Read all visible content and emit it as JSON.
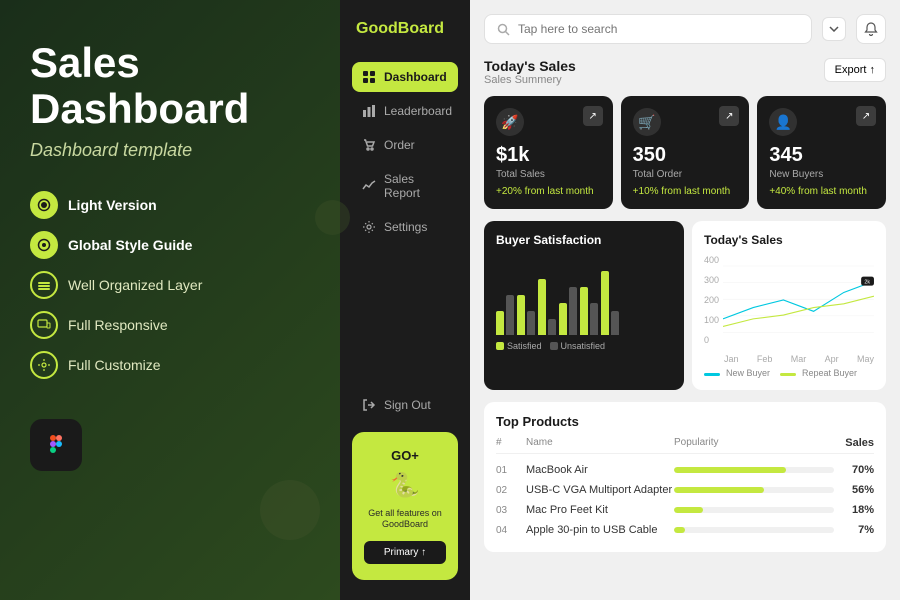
{
  "left": {
    "title_line1": "Sales",
    "title_line2": "Dashboard",
    "subtitle": "Dashboard template",
    "features": [
      {
        "id": "light",
        "label": "Light Version",
        "highlighted": true
      },
      {
        "id": "style",
        "label": "Global Style Guide",
        "highlighted": true
      },
      {
        "id": "layer",
        "label": "Well Organized Layer",
        "highlighted": false
      },
      {
        "id": "responsive",
        "label": "Full Responsive",
        "highlighted": false
      },
      {
        "id": "customize",
        "label": "Full Customize",
        "highlighted": false
      }
    ]
  },
  "sidebar": {
    "brand": "GoodBoard",
    "nav_items": [
      {
        "id": "dashboard",
        "label": "Dashboard",
        "active": true
      },
      {
        "id": "leaderboard",
        "label": "Leaderboard",
        "active": false
      },
      {
        "id": "order",
        "label": "Order",
        "active": false
      },
      {
        "id": "sales_report",
        "label": "Sales Report",
        "active": false
      },
      {
        "id": "settings",
        "label": "Settings",
        "active": false
      },
      {
        "id": "sign_out",
        "label": "Sign Out",
        "active": false
      }
    ],
    "promo_card": {
      "badge": "GO+",
      "description": "Get all features on GoodBoard",
      "button_label": "Primary ↑"
    }
  },
  "header": {
    "search_placeholder": "Tap here to search"
  },
  "todays_sales": {
    "title": "Today's Sales",
    "subtitle": "Sales Summery",
    "export_label": "Export ↑",
    "stats": [
      {
        "id": "total_sales",
        "value": "$1k",
        "label": "Total Sales",
        "change": "+20% from last month"
      },
      {
        "id": "total_order",
        "value": "350",
        "label": "Total Order",
        "change": "+10% from last month"
      },
      {
        "id": "new_buyers",
        "value": "345",
        "label": "New Buyers",
        "change": "+40% from last month"
      }
    ]
  },
  "buyer_satisfaction": {
    "title": "Buyer Satisfaction",
    "bars": [
      {
        "satisfied": 30,
        "unsatisfied": 50
      },
      {
        "satisfied": 50,
        "unsatisfied": 30
      },
      {
        "satisfied": 70,
        "unsatisfied": 20
      },
      {
        "satisfied": 40,
        "unsatisfied": 60
      },
      {
        "satisfied": 60,
        "unsatisfied": 40
      },
      {
        "satisfied": 80,
        "unsatisfied": 30
      }
    ],
    "legend_satisfied": "Satisfied",
    "legend_unsatisfied": "Unsatisfied"
  },
  "line_chart": {
    "title": "Today's Sales",
    "y_labels": [
      "400",
      "300",
      "200",
      "100",
      "0"
    ],
    "x_labels": [
      "Jan",
      "Feb",
      "Mar",
      "Apr",
      "May"
    ],
    "legend_new": "New Buyer",
    "legend_repeat": "Repeat Buyer",
    "current_value": "2k"
  },
  "top_products": {
    "title": "Top Products",
    "headers": [
      "#",
      "Name",
      "Popularity",
      "Sales"
    ],
    "items": [
      {
        "num": "01",
        "name": "MacBook Air",
        "popularity": 70,
        "sales": "70%"
      },
      {
        "num": "02",
        "name": "USB-C VGA Multiport Adapter",
        "popularity": 56,
        "sales": "56%"
      },
      {
        "num": "03",
        "name": "Mac Pro Feet Kit",
        "popularity": 18,
        "sales": "18%"
      },
      {
        "num": "04",
        "name": "Apple 30-pin to USB Cable",
        "popularity": 7,
        "sales": "7%"
      }
    ]
  },
  "colors": {
    "accent": "#c4e840",
    "dark_bg": "#1a1a1a",
    "sidebar_bg": "#1c1c1c",
    "main_bg": "#f0f0f0"
  }
}
